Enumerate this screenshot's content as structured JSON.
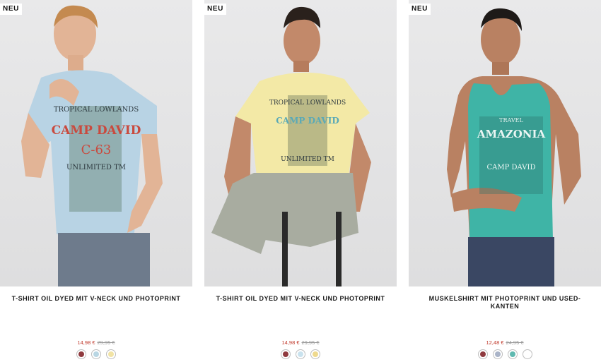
{
  "products": [
    {
      "badge": "NEU",
      "title": "T-SHIRT OIL DYED MIT V-NECK UND PHOTOPRINT",
      "price_now": "14,98 €",
      "price_was": "29,95 €",
      "shirt_color": "#b8d3e4",
      "print_texts": [
        "TROPICAL LOWLANDS",
        "CAMP DAVID",
        "C-63",
        "UNLIMITED TM"
      ],
      "swatches": [
        "#8f3a3f",
        "#b9d6e3",
        "#f1e3a5"
      ]
    },
    {
      "badge": "NEU",
      "title": "T-SHIRT OIL DYED MIT V-NECK UND PHOTOPRINT",
      "price_now": "14,98 €",
      "price_was": "29,95 €",
      "shirt_color": "#f3e9a6",
      "print_texts": [
        "TROPICAL LOWLANDS",
        "CAMP DAVID",
        "UNLIMITED TM"
      ],
      "swatches": [
        "#8f3a3f",
        "#c9e2ee",
        "#eed98e"
      ]
    },
    {
      "badge": "NEU",
      "title": "MUSKELSHIRT MIT PHOTOPRINT UND USED-KANTEN",
      "price_now": "12,48 €",
      "price_was": "24,95 €",
      "shirt_color": "#3fb4a6",
      "print_texts": [
        "TRAVEL",
        "AMAZONIA",
        "CAMP DAVID"
      ],
      "swatches": [
        "#8f3a3f",
        "#aab4c8",
        "#5fb9b0",
        "#ffffff"
      ]
    }
  ]
}
